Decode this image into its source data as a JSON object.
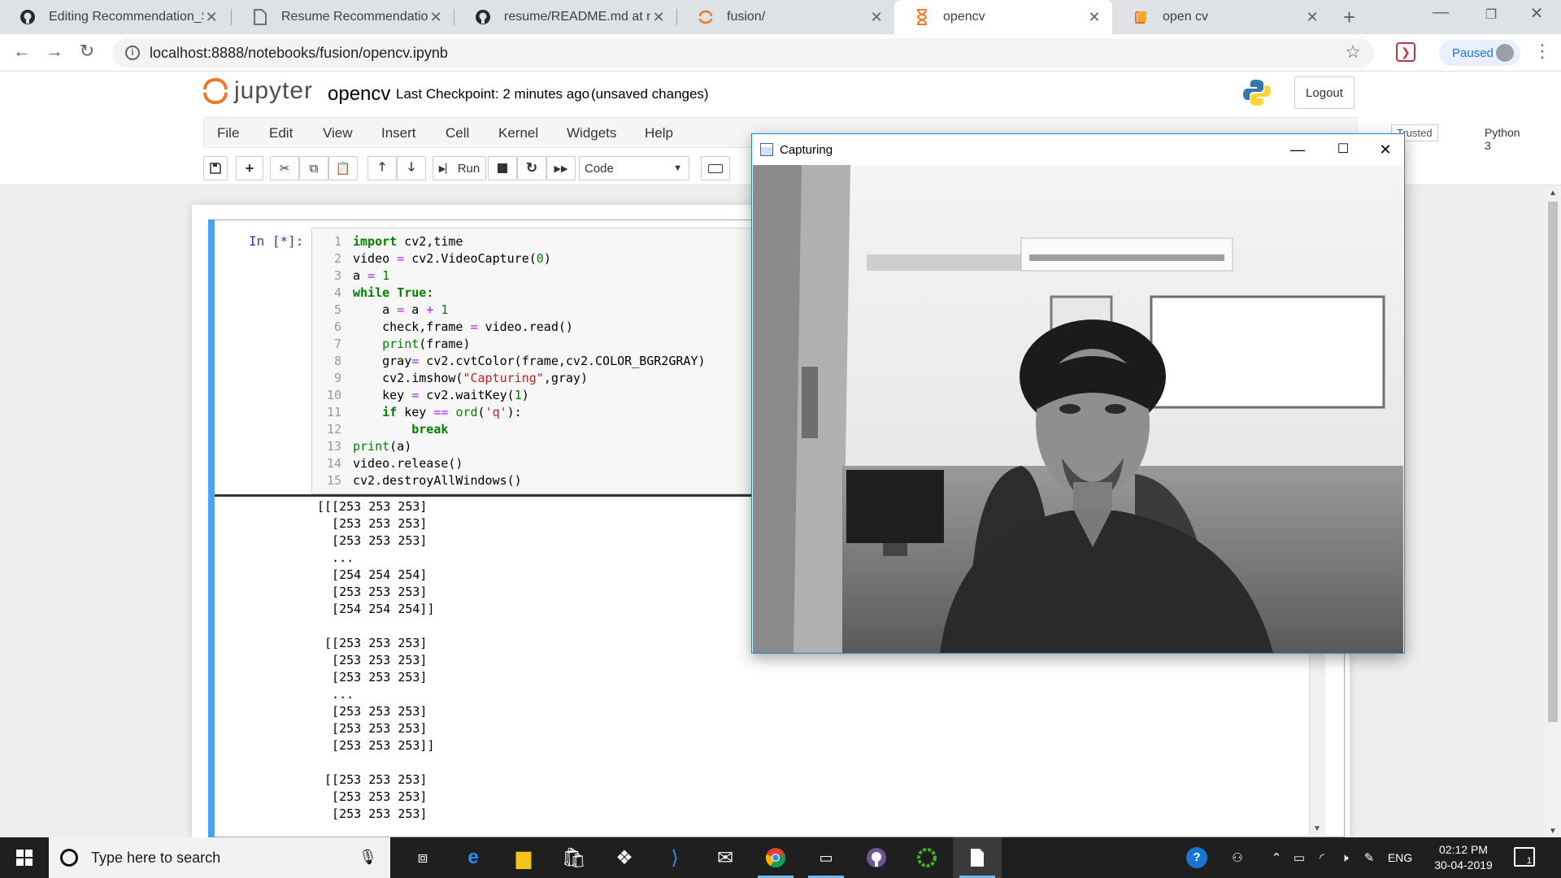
{
  "browser": {
    "tabs": [
      {
        "label": "Editing Recommendation_Sy",
        "icon": "github-icon"
      },
      {
        "label": "Resume Recommendation",
        "icon": "document-icon"
      },
      {
        "label": "resume/README.md at mast",
        "icon": "github-icon"
      },
      {
        "label": "fusion/",
        "icon": "jupyter-icon"
      },
      {
        "label": "opencv",
        "icon": "hourglass-icon"
      },
      {
        "label": "open cv",
        "icon": "notebook-icon"
      }
    ],
    "url": "localhost:8888/notebooks/fusion/opencv.ipynb",
    "profile_status": "Paused"
  },
  "jupyter": {
    "logo_text": "jupyter",
    "notebook_name": "opencv",
    "checkpoint": "Last Checkpoint: 2 minutes ago",
    "status": "(unsaved changes)",
    "logout_label": "Logout",
    "menu": [
      "File",
      "Edit",
      "View",
      "Insert",
      "Cell",
      "Kernel",
      "Widgets",
      "Help"
    ],
    "trusted_label": "Trusted",
    "kernel_label": "Python 3",
    "run_label": "Run",
    "cell_type": "Code"
  },
  "cell": {
    "prompt": "In [*]:",
    "line_numbers": [
      "1",
      "2",
      "3",
      "4",
      "5",
      "6",
      "7",
      "8",
      "9",
      "10",
      "11",
      "12",
      "13",
      "14",
      "15"
    ],
    "output_lines": [
      "[[[253 253 253]",
      "  [253 253 253]",
      "  [253 253 253]",
      "  ...",
      "  [254 254 254]",
      "  [253 253 253]",
      "  [254 254 254]]",
      "",
      " [[253 253 253]",
      "  [253 253 253]",
      "  [253 253 253]",
      "  ...",
      "  [253 253 253]",
      "  [253 253 253]",
      "  [253 253 253]]",
      "",
      " [[253 253 253]",
      "  [253 253 253]",
      "  [253 253 253]"
    ]
  },
  "capture_window": {
    "title": "Capturing"
  },
  "taskbar": {
    "search_placeholder": "Type here to search",
    "language": "ENG",
    "time": "02:12 PM",
    "date": "30-04-2019",
    "notification_count": "1"
  }
}
